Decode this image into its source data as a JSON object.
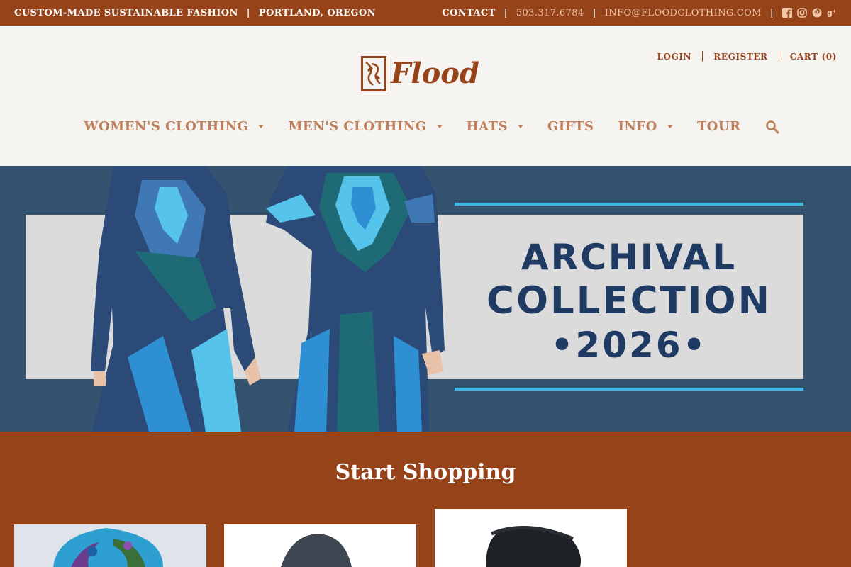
{
  "topbar": {
    "tagline": "CUSTOM-MADE SUSTAINABLE FASHION",
    "location": "PORTLAND, OREGON",
    "contact": "CONTACT",
    "phone": "503.317.6784",
    "email": "INFO@FLOODCLOTHING.COM",
    "separator": "|",
    "social_icons": [
      "facebook-icon",
      "instagram-icon",
      "pinterest-icon",
      "google-plus-icon"
    ]
  },
  "account": {
    "login": "LOGIN",
    "register": "REGISTER",
    "cart": "CART (0)"
  },
  "logo": {
    "text": "Flood"
  },
  "nav": {
    "items": [
      {
        "label": "WOMEN'S CLOTHING",
        "dropdown": true
      },
      {
        "label": "MEN'S CLOTHING",
        "dropdown": true
      },
      {
        "label": "HATS",
        "dropdown": true
      },
      {
        "label": "GIFTS",
        "dropdown": false
      },
      {
        "label": "INFO",
        "dropdown": true
      },
      {
        "label": "TOUR",
        "dropdown": false
      }
    ],
    "search_icon": "search-icon"
  },
  "hero": {
    "line1": "ARCHIVAL",
    "line2": "COLLECTION",
    "line3": "•2026•"
  },
  "shop": {
    "title": "Start Shopping"
  },
  "colors": {
    "brand": "#97431a",
    "nav_text": "#c07e5a",
    "hero_bg": "#33536f",
    "hero_text": "#1f3a63",
    "accent": "#3fb7e0"
  }
}
